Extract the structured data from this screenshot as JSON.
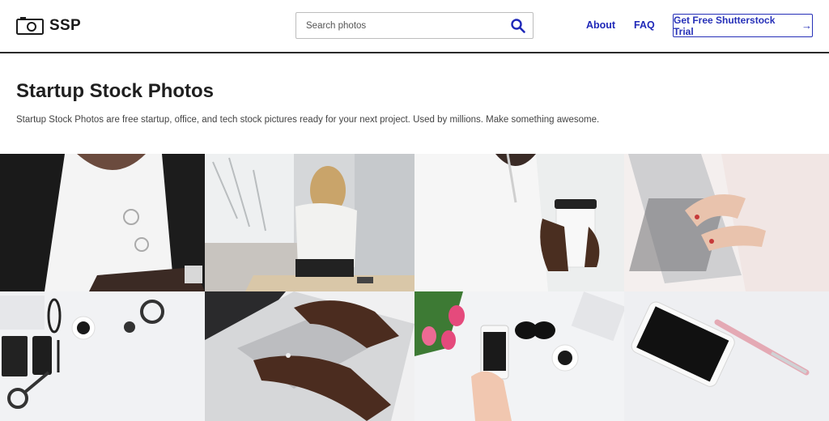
{
  "header": {
    "logo_text": "SSP",
    "logo_icon": "camera-icon",
    "search": {
      "placeholder": "Search photos",
      "icon": "search-icon"
    },
    "nav": {
      "about": "About",
      "faq": "FAQ"
    },
    "cta": {
      "label": "Get Free Shutterstock Trial",
      "arrow": "→"
    }
  },
  "intro": {
    "title": "Startup Stock Photos",
    "description": "Startup Stock Photos are free startup, office, and tech stock pictures ready for your next project. Used by millions. Make something awesome."
  },
  "colors": {
    "accent": "#1f28b8",
    "header_border": "#2b2b2b"
  }
}
